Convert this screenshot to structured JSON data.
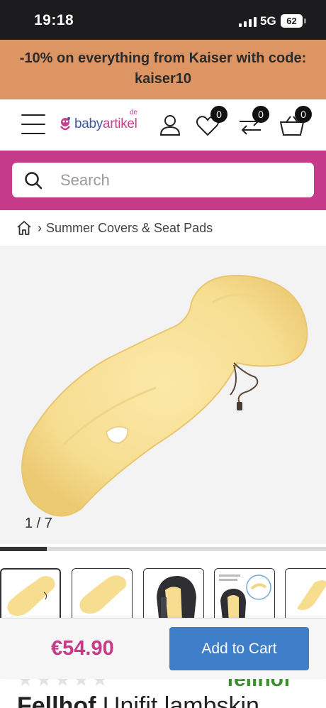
{
  "status_bar": {
    "time": "19:18",
    "network": "5G",
    "battery": "62"
  },
  "promo": {
    "line1": "-10% on everything from Kaiser with code:",
    "line2": "kaiser10"
  },
  "header": {
    "logo": {
      "part1": "baby",
      "part2": "artikel",
      "suffix": "de"
    },
    "wishlist_count": "0",
    "compare_count": "0",
    "cart_count": "0"
  },
  "search": {
    "placeholder": "Search"
  },
  "breadcrumb": {
    "current": "Summer Covers & Seat Pads"
  },
  "gallery": {
    "counter": "1 / 7",
    "progress": 0.143,
    "thumbnail_count": 5
  },
  "product": {
    "price": "€54.90",
    "add_to_cart_label": "Add to Cart",
    "rating_stars": "★★★★★",
    "brand_partial": "fellhof",
    "title_brand": "Fellhof",
    "title_rest": " Unifit lambskin"
  },
  "colors": {
    "promo_bg": "#dc9563",
    "accent_pink": "#c53b8a",
    "button_blue": "#3f7ec8",
    "status_bg": "#1c1c1e"
  }
}
